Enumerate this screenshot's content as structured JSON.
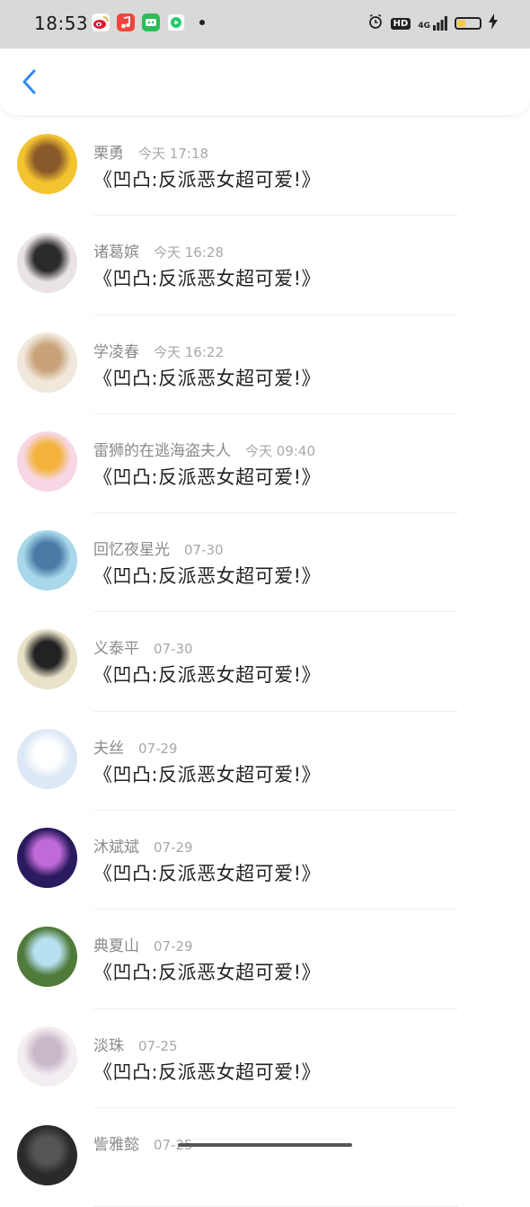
{
  "status_bar": {
    "time": "18:53",
    "app_icons": [
      "weibo-icon",
      "music-icon",
      "wechat-mini-icon",
      "video-icon"
    ],
    "hd_label": "HD",
    "network_label": "4G",
    "battery_level": 0.35,
    "colors": {
      "background": "#d9d9d9",
      "battery_fill": "#f2c94c"
    }
  },
  "header": {
    "back_icon": "chevron-left-icon",
    "accent": "#2d8cf0"
  },
  "comments": [
    {
      "name": "栗勇",
      "time": "今天 17:18",
      "message": "《凹凸:反派恶女超可爱!》",
      "avatar_colors": [
        "#f4c430",
        "#8b5a2b"
      ]
    },
    {
      "name": "诸葛嫔",
      "time": "今天 16:28",
      "message": "《凹凸:反派恶女超可爱!》",
      "avatar_colors": [
        "#e9e2e6",
        "#2b2b2b"
      ]
    },
    {
      "name": "学凌春",
      "time": "今天 16:22",
      "message": "《凹凸:反派恶女超可爱!》",
      "avatar_colors": [
        "#f1e8dc",
        "#c9a27a"
      ]
    },
    {
      "name": "雷狮的在逃海盗夫人",
      "time": "今天 09:40",
      "message": "《凹凸:反派恶女超可爱!》",
      "avatar_colors": [
        "#f7d7e5",
        "#f3b33d"
      ]
    },
    {
      "name": "回忆夜星光",
      "time": "07-30",
      "message": "《凹凸:反派恶女超可爱!》",
      "avatar_colors": [
        "#a8d8ea",
        "#4a7aa6"
      ]
    },
    {
      "name": "义泰平",
      "time": "07-30",
      "message": "《凹凸:反派恶女超可爱!》",
      "avatar_colors": [
        "#e8e2c9",
        "#222222"
      ]
    },
    {
      "name": "夫丝",
      "time": "07-29",
      "message": "《凹凸:反派恶女超可爱!》",
      "avatar_colors": [
        "#dce8f5",
        "#ffffff"
      ]
    },
    {
      "name": "沐斌斌",
      "time": "07-29",
      "message": "《凹凸:反派恶女超可爱!》",
      "avatar_colors": [
        "#2a1a5e",
        "#c06ad8"
      ]
    },
    {
      "name": "典夏山",
      "time": "07-29",
      "message": "《凹凸:反派恶女超可爱!》",
      "avatar_colors": [
        "#4f7a3a",
        "#b7e0f0"
      ]
    },
    {
      "name": "淡珠",
      "time": "07-25",
      "message": "《凹凸:反派恶女超可爱!》",
      "avatar_colors": [
        "#f3eef2",
        "#c9b8c8"
      ]
    },
    {
      "name": "訾雅懿",
      "time": "07-25",
      "message": "",
      "avatar_colors": [
        "#2a2a2a",
        "#555555"
      ]
    }
  ]
}
